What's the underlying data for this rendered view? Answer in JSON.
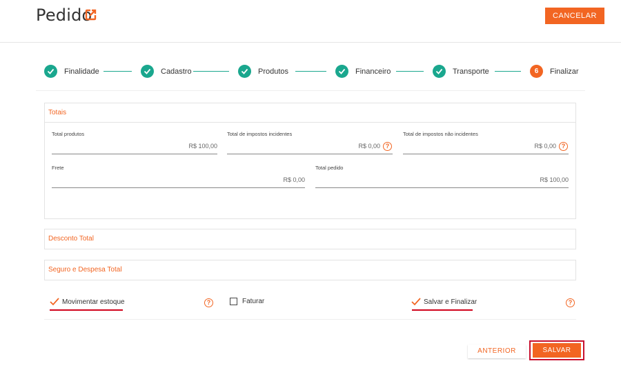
{
  "header": {
    "title": "Pedido",
    "cancel_label": "CANCELAR",
    "title_icon": "edit-square-icon"
  },
  "steps": [
    {
      "label": "Finalidade",
      "status": "done"
    },
    {
      "label": "Cadastro",
      "status": "done"
    },
    {
      "label": "Produtos",
      "status": "done"
    },
    {
      "label": "Financeiro",
      "status": "done"
    },
    {
      "label": "Transporte",
      "status": "done"
    },
    {
      "label": "Finalizar",
      "status": "current",
      "number": "6"
    }
  ],
  "totais": {
    "title": "Totais",
    "total_produtos": {
      "label": "Total produtos",
      "value": "R$ 100,00"
    },
    "impostos_incidentes": {
      "label": "Total de impostos incidentes",
      "value": "R$ 0,00"
    },
    "impostos_nao_incidentes": {
      "label": "Total de impostos não incidentes",
      "value": "R$ 0,00"
    },
    "frete": {
      "label": "Frete",
      "value": "R$ 0,00"
    },
    "total_pedido": {
      "label": "Total pedido",
      "value": "R$ 100,00"
    }
  },
  "desconto": {
    "title": "Desconto Total"
  },
  "seguro": {
    "title": "Seguro e Despesa Total"
  },
  "options": {
    "movimentar": {
      "label": "Movimentar estoque",
      "checked": true
    },
    "faturar": {
      "label": "Faturar",
      "checked": false
    },
    "salvar_finalizar": {
      "label": "Salvar e Finalizar",
      "checked": true
    }
  },
  "footer": {
    "anterior_label": "ANTERIOR",
    "salvar_label": "SALVAR"
  },
  "colors": {
    "accent": "#f26522",
    "success": "#1aa78e",
    "highlight": "#d0021b"
  }
}
